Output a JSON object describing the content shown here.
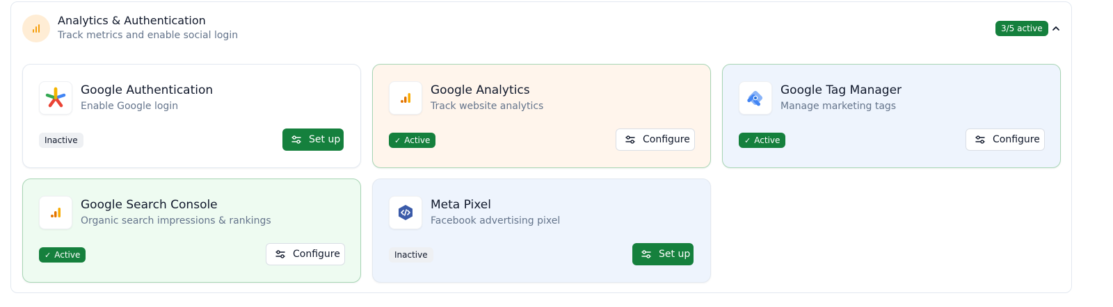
{
  "section": {
    "title": "Analytics & Authentication",
    "subtitle": "Track metrics and enable social login",
    "icon": "bar-chart-icon",
    "active_count": "3/5 active",
    "collapse_icon": "chevron-up-icon"
  },
  "colors": {
    "primary_green": "#15803d",
    "orange_accent": "#f59e0b",
    "meta_blue": "#3b5ba9"
  },
  "integrations": [
    {
      "name": "Google Authentication",
      "description": "Enable Google login",
      "status": "Inactive",
      "action": "Set up",
      "logo": "google-auth-logo",
      "tint": "white"
    },
    {
      "name": "Google Analytics",
      "description": "Track website analytics",
      "status": "Active",
      "action": "Configure",
      "logo": "google-analytics-logo",
      "tint": "orange"
    },
    {
      "name": "Google Tag Manager",
      "description": "Manage marketing tags",
      "status": "Active",
      "action": "Configure",
      "logo": "google-tag-manager-logo",
      "tint": "blue"
    },
    {
      "name": "Google Search Console",
      "description": "Organic search impressions & rankings",
      "status": "Active",
      "action": "Configure",
      "logo": "google-search-console-logo",
      "tint": "green"
    },
    {
      "name": "Meta Pixel",
      "description": "Facebook advertising pixel",
      "status": "Inactive",
      "action": "Set up",
      "logo": "meta-pixel-logo",
      "tint": "blue"
    }
  ]
}
